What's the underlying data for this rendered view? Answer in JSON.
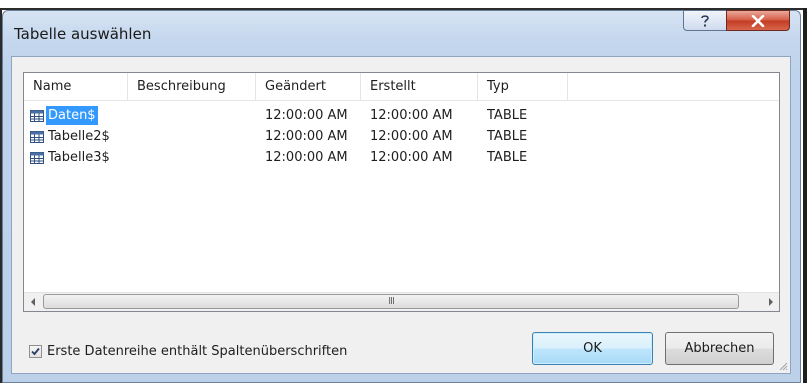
{
  "window": {
    "title": "Tabelle auswählen"
  },
  "titlebar": {
    "help_icon": "question-icon",
    "close_icon": "close-x-icon"
  },
  "table": {
    "columns": [
      "Name",
      "Beschreibung",
      "Geändert",
      "Erstellt",
      "Typ"
    ],
    "rows": [
      {
        "name": "Daten$",
        "beschreibung": "",
        "geaendert": "12:00:00 AM",
        "erstellt": "12:00:00 AM",
        "typ": "TABLE",
        "selected": true
      },
      {
        "name": "Tabelle2$",
        "beschreibung": "",
        "geaendert": "12:00:00 AM",
        "erstellt": "12:00:00 AM",
        "typ": "TABLE",
        "selected": false
      },
      {
        "name": "Tabelle3$",
        "beschreibung": "",
        "geaendert": "12:00:00 AM",
        "erstellt": "12:00:00 AM",
        "typ": "TABLE",
        "selected": false
      }
    ]
  },
  "scrollbar": {
    "grip": "III"
  },
  "options": {
    "header_checkbox_label": "Erste Datenreihe enthält Spaltenüberschriften",
    "header_checkbox_checked": true
  },
  "buttons": {
    "ok": "OK",
    "cancel": "Abbrechen"
  },
  "colors": {
    "selection": "#3399ff",
    "title_bar": "#c5d7ee",
    "close_button": "#c33b23"
  }
}
